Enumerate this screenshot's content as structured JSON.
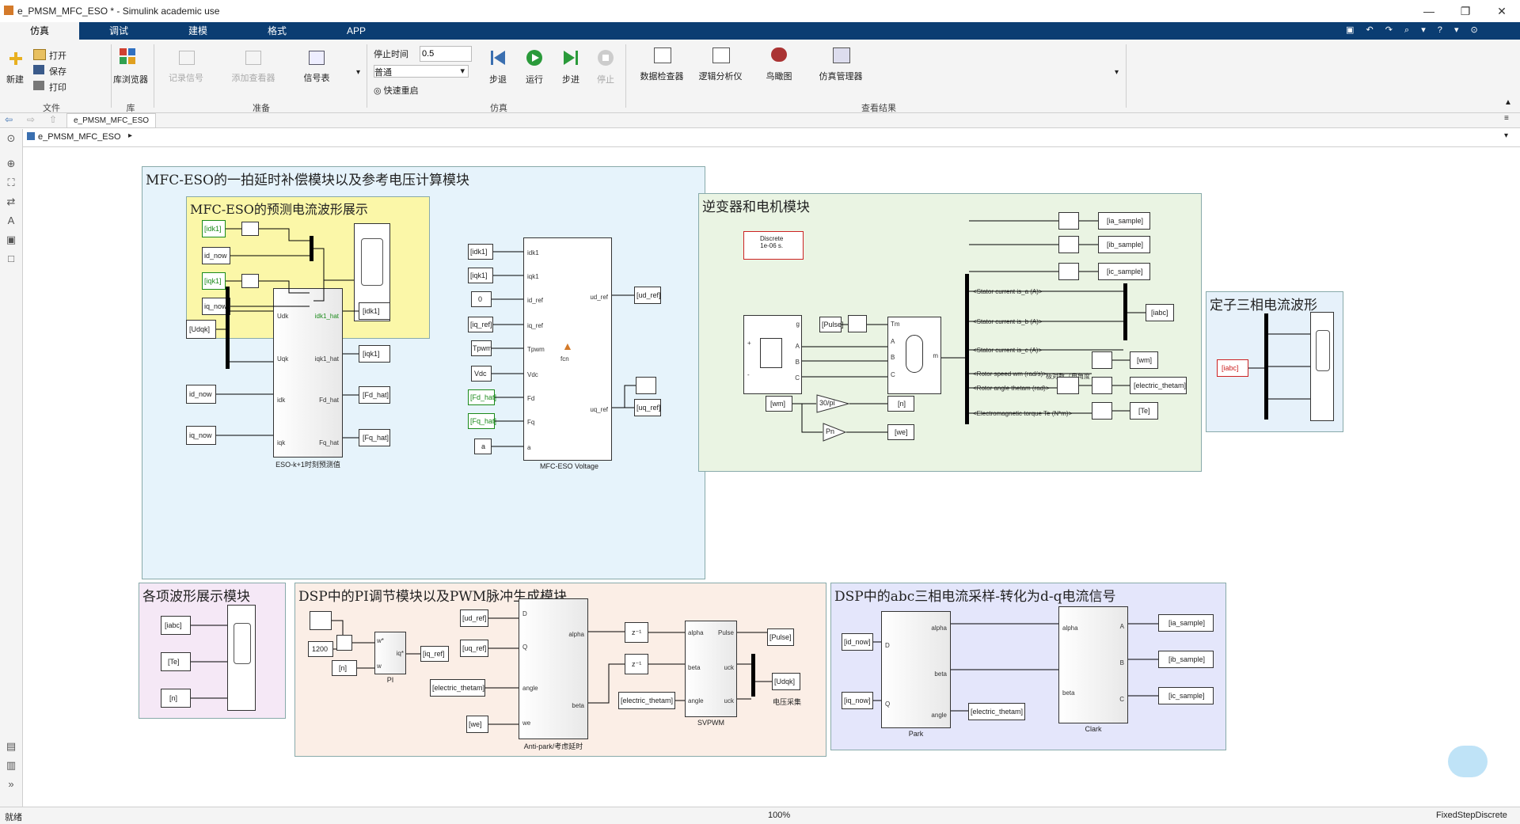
{
  "window": {
    "title": "e_PMSM_MFC_ESO * - Simulink academic use",
    "minimize": "—",
    "maximize": "❐",
    "close": "✕"
  },
  "menu": {
    "tabs": [
      "仿真",
      "调试",
      "建模",
      "格式",
      "APP"
    ]
  },
  "ribbon": {
    "file": {
      "new": "新建",
      "open": "打开",
      "save": "保存",
      "print": "打印",
      "group": "文件"
    },
    "library": {
      "browser": "库浏览器",
      "group": "库"
    },
    "prepare": {
      "log_signals": "记录信号",
      "add_viewer": "添加查看器",
      "signal_table": "信号表",
      "group": "准备"
    },
    "simulate": {
      "stop_time_label": "停止时间",
      "stop_time_value": "0.5",
      "mode": "普通",
      "fast_restart": "快速重启",
      "step_back": "步退",
      "run": "运行",
      "step_forward": "步进",
      "stop": "停止",
      "group": "仿真"
    },
    "review": {
      "data_inspector": "数据检查器",
      "logic_analyzer": "逻辑分析仪",
      "bird_eye": "鸟瞰图",
      "sim_manager": "仿真管理器",
      "group": "查看结果"
    }
  },
  "address": {
    "tab": "e_PMSM_MFC_ESO",
    "path": "e_PMSM_MFC_ESO"
  },
  "status": {
    "left": "就绪",
    "zoom": "100%",
    "solver": "FixedStepDiscrete"
  },
  "areas": {
    "mfc_eso": "MFC-ESO的一拍延时补偿模块以及参考电压计算模块",
    "mfc_pred": "MFC-ESO的预测电流波形展示",
    "inverter": "逆变器和电机模块",
    "stator": "定子三相电流波形",
    "waveforms": "各项波形展示模块",
    "dsp_pi": "DSP中的PI调节模块以及PWM脉冲生成模块",
    "dsp_abc": "DSP中的abc三相电流采样-转化为d-q电流信号"
  },
  "blocks": {
    "pred_tags": [
      "[idk1]",
      "id_now",
      "[iqk1]",
      "iq_now"
    ],
    "eso_in": [
      "[Udqk]",
      "id_now",
      "iq_now"
    ],
    "eso_ports_in": [
      "Udk",
      "Uqk",
      "idk",
      "iqk"
    ],
    "eso_ports_out": [
      "idk1_hat",
      "iqk1_hat",
      "Fd_hat",
      "Fq_hat"
    ],
    "eso_out": [
      "[idk1]",
      "[iqk1]",
      "[Fd_hat]",
      "[Fq_hat]"
    ],
    "eso_caption": "ESO-k+1时刻预测值",
    "volt_in": [
      "[idk1]",
      "[iqk1]",
      "0",
      "[iq_ref]",
      "Tpwm",
      "Vdc",
      "[Fd_hat]",
      "[Fq_hat]",
      "a"
    ],
    "volt_ports": [
      "idk1",
      "iqk1",
      "id_ref",
      "iq_ref",
      "Tpwm",
      "Vdc",
      "Fd",
      "Fq",
      "a"
    ],
    "volt_out_ports": [
      "ud_ref",
      "uq_ref"
    ],
    "volt_out": [
      "[ud_ref]",
      "[uq_ref]"
    ],
    "volt_fcn": "fcn",
    "volt_caption": "MFC-ESO Voltage",
    "discrete": "Discrete\n1e-06 s.",
    "samples": [
      "[ia_sample]",
      "[ib_sample]",
      "[ic_sample]"
    ],
    "iabc": "[iabc]",
    "pulse": "[Pulse]",
    "meas": [
      "<Stator current is_a (A)>",
      "<Stator current is_b (A)>",
      "<Stator current is_c (A)>",
      "<Rotor speed wm (rad/s)>",
      "<Rotor angle thetam (rad)>",
      "<Electromagnetic torque Te (N*m)>"
    ],
    "meas_note": "极对数（电角度",
    "motor_out": [
      "[wm]",
      "[electric_thetam]",
      "[Te]"
    ],
    "wm_in": "[wm]",
    "gain1": "30/pi",
    "n_tag": "[n]",
    "gain2": "Pn",
    "we_tag": "[we]",
    "stator_in": "[iabc]",
    "wave_in": [
      "[iabc]",
      "[Te]",
      "[n]"
    ],
    "pi_ref": "1200",
    "pi_n": "[n]",
    "pi_label": "w*",
    "pi_out": "iq*",
    "pi_w": "w",
    "pi_caption": "PI",
    "iq_ref_tag": "[iq_ref]",
    "ap_in": [
      "[ud_ref]",
      "[uq_ref]",
      "[electric_thetam]",
      "[we]"
    ],
    "ap_ports": [
      "D",
      "Q",
      "angle",
      "we"
    ],
    "ap_out_ports": [
      "alpha",
      "beta"
    ],
    "ap_caption": "Anti-park/考虑延时",
    "zinv": "z⁻¹",
    "svp_ports": [
      "alpha",
      "beta",
      "angle"
    ],
    "svp_out_ports": [
      "Pulse",
      "uck",
      "uck"
    ],
    "svp_in": "[electric_thetam]",
    "svp_caption": "SVPWM",
    "svp_out": [
      "[Pulse]",
      "[Udqk]"
    ],
    "svp_note": "电压采集",
    "park_out": [
      "[id_now]",
      "[iq_now]"
    ],
    "park_ports": [
      "D",
      "Q",
      "alpha",
      "beta",
      "angle"
    ],
    "park_caption": "Park",
    "park_theta": "[electric_thetam]",
    "clark_ports_out": [
      "alpha",
      "beta"
    ],
    "clark_ports_in": [
      "A",
      "B",
      "C"
    ],
    "clark_caption": "Clark",
    "clark_in": [
      "[ia_sample]",
      "[ib_sample]",
      "[ic_sample]"
    ],
    "inv_ports": [
      "g",
      "+",
      "-",
      "A",
      "B",
      "C"
    ],
    "motor_ports": [
      "Tm",
      "A",
      "B",
      "C",
      "m"
    ]
  },
  "colors": {
    "titlebar": "#ffffff",
    "menubar": "#0b3d72",
    "area_mfc": "#e6f3fb",
    "area_pred": "#fbf7a8",
    "area_inv": "#eaf4e3",
    "area_stator": "#e6f1fa",
    "area_wave": "#f5e8f6",
    "area_dsp": "#fbeee6",
    "area_abc": "#e4e6fb"
  }
}
